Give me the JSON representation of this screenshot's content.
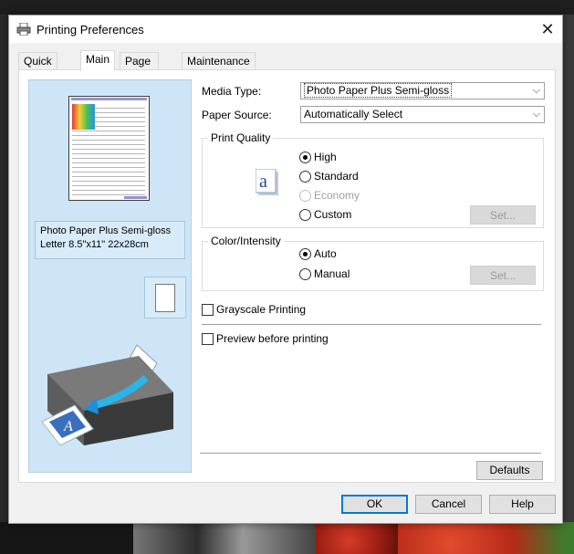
{
  "window": {
    "title": "Printing Preferences"
  },
  "tabs": [
    {
      "label": "Quick Setup"
    },
    {
      "label": "Main"
    },
    {
      "label": "Page Setup"
    },
    {
      "label": "Maintenance"
    }
  ],
  "preview": {
    "media_line1": "Photo Paper Plus Semi-gloss",
    "media_line2": "Letter 8.5\"x11\" 22x28cm"
  },
  "main": {
    "media_type_label": "Media Type:",
    "media_type_value": "Photo Paper Plus Semi-gloss",
    "paper_source_label": "Paper Source:",
    "paper_source_value": "Automatically Select",
    "print_quality": {
      "title": "Print Quality",
      "options": [
        "High",
        "Standard",
        "Economy",
        "Custom"
      ],
      "selected": "High",
      "set_label": "Set..."
    },
    "color_intensity": {
      "title": "Color/Intensity",
      "options": [
        "Auto",
        "Manual"
      ],
      "selected": "Auto",
      "set_label": "Set..."
    },
    "grayscale_label": "Grayscale Printing",
    "grayscale_checked": false,
    "preview_label": "Preview before printing",
    "preview_checked": false,
    "defaults_label": "Defaults"
  },
  "footer": {
    "ok": "OK",
    "cancel": "Cancel",
    "help": "Help"
  },
  "icons": [
    "printer-icon",
    "close-icon",
    "chevron-down-icon",
    "quality-a-icon",
    "page-preview-icon",
    "orientation-icon",
    "printer-illustration"
  ],
  "colors": {
    "preview_panel": "#cde5f7",
    "focus_border": "#0078d7"
  }
}
